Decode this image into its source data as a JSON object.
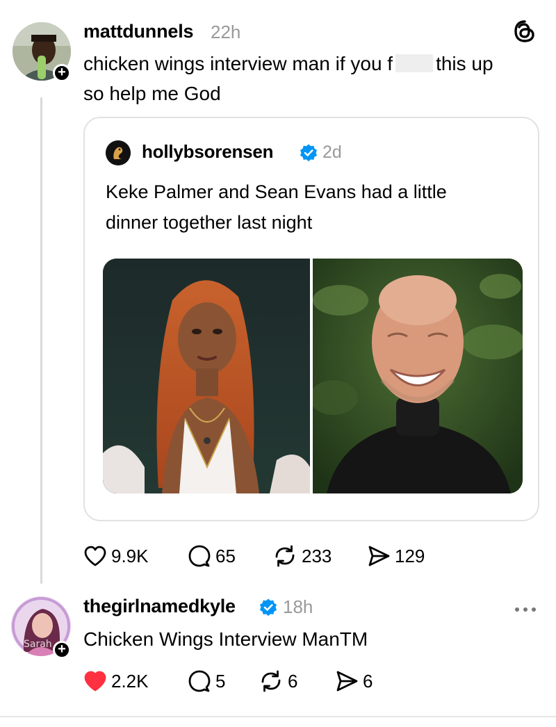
{
  "post": {
    "username": "mattdunnels",
    "time": "22h",
    "text_part1": "chicken wings interview man if you f",
    "text_part2": "this up",
    "text_line2": "so help me God",
    "stats": {
      "likes": "9.9K",
      "replies": "65",
      "reposts": "233",
      "shares": "129"
    }
  },
  "quote": {
    "username": "hollybsorensen",
    "time": "2d",
    "text_line1": "Keke Palmer and Sean Evans had a little",
    "text_line2": "dinner together last night"
  },
  "reply": {
    "username": "thegirlnamedkyle",
    "time": "18h",
    "text": "Chicken Wings Interview ManTM",
    "stats": {
      "likes": "2.2K",
      "replies": "5",
      "reposts": "6",
      "shares": "6"
    }
  },
  "colors": {
    "verified": "#0095f6",
    "liked": "#ff3040",
    "muted": "#999999"
  },
  "icons": [
    "threads-logo-icon",
    "plus-icon",
    "verified-icon",
    "heart-icon",
    "comment-icon",
    "repost-icon",
    "share-icon",
    "more-icon"
  ]
}
